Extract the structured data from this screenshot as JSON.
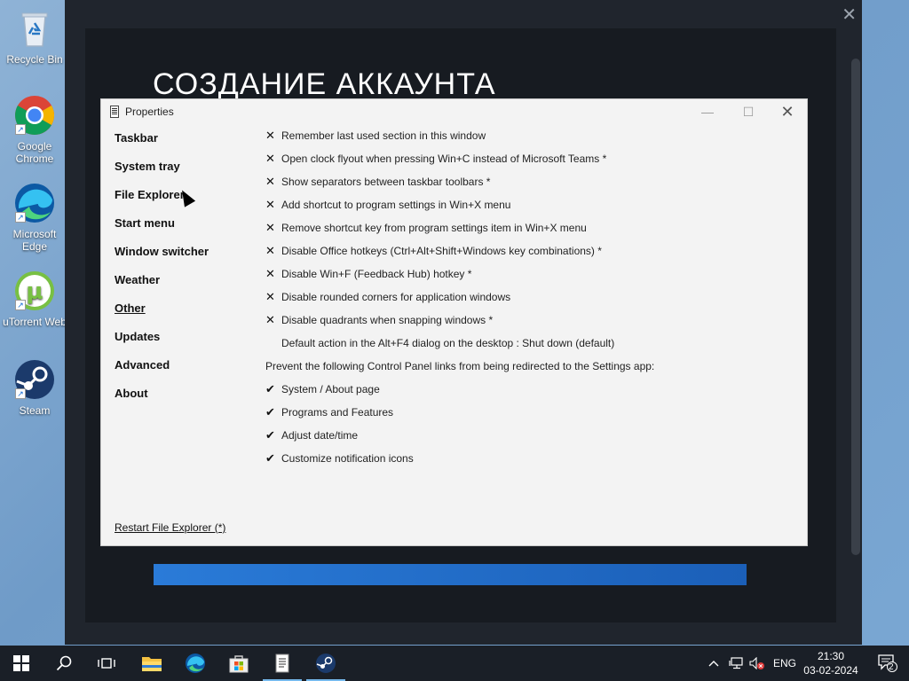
{
  "desktop": {
    "icons": [
      {
        "label": "Recycle Bin",
        "icon": "recycle-bin-icon"
      },
      {
        "label": "Google Chrome",
        "icon": "chrome-icon"
      },
      {
        "label": "Microsoft Edge",
        "icon": "edge-icon"
      },
      {
        "label": "uTorrent Web",
        "icon": "utorrent-icon"
      },
      {
        "label": "Steam",
        "icon": "steam-icon"
      }
    ]
  },
  "steam_dialog": {
    "title": "СОЗДАНИЕ АККАУНТА",
    "close_glyph": "✕"
  },
  "properties": {
    "title": "Properties",
    "nav": [
      {
        "label": "Taskbar"
      },
      {
        "label": "System tray"
      },
      {
        "label": "File Explorer"
      },
      {
        "label": "Start menu"
      },
      {
        "label": "Window switcher"
      },
      {
        "label": "Weather"
      },
      {
        "label": "Other",
        "active": true
      },
      {
        "label": "Updates"
      },
      {
        "label": "Advanced"
      },
      {
        "label": "About"
      }
    ],
    "options": [
      {
        "mark": "✕",
        "text": "Remember last used section in this window"
      },
      {
        "mark": "✕",
        "text": "Open clock flyout when pressing Win+C instead of Microsoft Teams *"
      },
      {
        "mark": "✕",
        "text": "Show separators between taskbar toolbars *"
      },
      {
        "mark": "✕",
        "text": "Add shortcut to program settings in Win+X menu"
      },
      {
        "mark": "✕",
        "text": "Remove shortcut key from program settings item in Win+X menu"
      },
      {
        "mark": "✕",
        "text": "Disable Office hotkeys (Ctrl+Alt+Shift+Windows key combinations) *"
      },
      {
        "mark": "✕",
        "text": "Disable Win+F (Feedback Hub) hotkey *"
      },
      {
        "mark": "✕",
        "text": "Disable rounded corners for application windows"
      },
      {
        "mark": "✕",
        "text": "Disable quadrants when snapping windows *"
      },
      {
        "mark": "",
        "text": "Default action in the Alt+F4 dialog on the desktop : Shut down (default)"
      }
    ],
    "section_heading": "Prevent the following Control Panel links from being redirected to the Settings app:",
    "redirects": [
      {
        "mark": "✔",
        "text": "System / About page"
      },
      {
        "mark": "✔",
        "text": "Programs and Features"
      },
      {
        "mark": "✔",
        "text": "Adjust date/time"
      },
      {
        "mark": "✔",
        "text": "Customize notification icons"
      }
    ],
    "restart_link": "Restart File Explorer (*)"
  },
  "taskbar": {
    "language": "ENG",
    "time": "21:30",
    "date": "03-02-2024",
    "notification_count": "2"
  },
  "colors": {
    "accent": "#76b9ed",
    "steam_bg": "#20252d",
    "taskbar_bg": "#1a1f27"
  }
}
